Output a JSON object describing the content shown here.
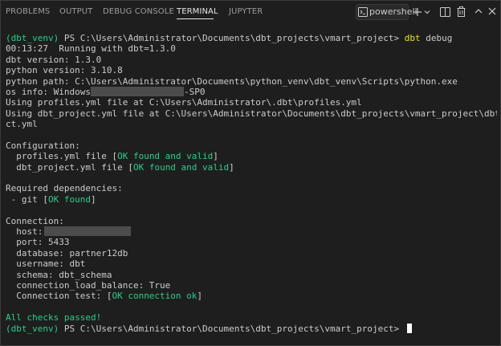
{
  "panel": {
    "tabs": [
      {
        "label": "PROBLEMS",
        "active": false
      },
      {
        "label": "OUTPUT",
        "active": false
      },
      {
        "label": "DEBUG CONSOLE",
        "active": false
      },
      {
        "label": "TERMINAL",
        "active": true
      },
      {
        "label": "JUPYTER",
        "active": false
      }
    ],
    "shell_label": "powershell",
    "toolbar_icons": [
      "terminal-icon",
      "plus-icon",
      "chevron-down-icon",
      "split-icon",
      "trash-icon",
      "chevron-up-icon",
      "close-icon"
    ]
  },
  "terminal": {
    "prompt_env": "(dbt_venv)",
    "prompt_path": " PS C:\\Users\\Administrator\\Documents\\dbt_projects\\vmart_project> ",
    "command_name": "dbt",
    "command_args": " debug",
    "line_time": "00:13:27  Running with dbt=1.3.0",
    "line_dbt_version": "dbt version: 1.3.0",
    "line_python_version": "python version: 3.10.8",
    "line_python_path": "python path: C:\\Users\\Administrator\\Documents\\python_venv\\dbt_venv\\Scripts\\python.exe",
    "os_info_prefix": "os info: Windows",
    "os_info_suffix": "-SP0",
    "line_profiles_file": "Using profiles.yml file at C:\\Users\\Administrator\\.dbt\\profiles.yml",
    "line_project_file_1": "Using dbt_project.yml file at C:\\Users\\Administrator\\Documents\\dbt_projects\\vmart_project\\dbt_proje",
    "line_project_file_2": "ct.yml",
    "configuration_header": "Configuration:",
    "profiles_check_label": "  profiles.yml file [",
    "profiles_check_status": "OK found and valid",
    "profiles_check_close": "]",
    "project_check_label": "  dbt_project.yml file [",
    "project_check_status": "OK found and valid",
    "project_check_close": "]",
    "dependencies_header": "Required dependencies:",
    "git_check_label": " - git [",
    "git_check_status": "OK found",
    "git_check_close": "]",
    "connection_header": "Connection:",
    "host_label": "  host:",
    "port_line": "  port: 5433",
    "database_line": "  database: partner12db",
    "username_line": "  username: dbt",
    "schema_line": "  schema: dbt_schema",
    "load_balance_line": "  connection_load_balance: True",
    "connection_test_label": "  Connection test: [",
    "connection_test_status": "OK connection ok",
    "connection_test_close": "]",
    "all_passed": "All checks passed!"
  }
}
